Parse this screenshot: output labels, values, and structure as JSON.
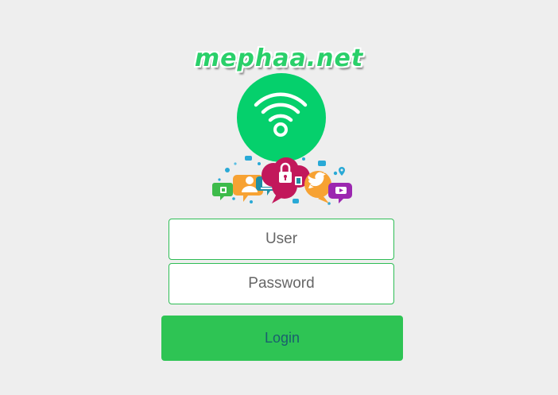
{
  "brand": {
    "name": "mephaa.net",
    "color": "#2ad06a"
  },
  "icons": {
    "badge": "wifi-icon",
    "illustration": "social-media-bubbles-illustration"
  },
  "form": {
    "user_placeholder": "User",
    "password_placeholder": "Password",
    "login_label": "Login"
  },
  "colors": {
    "background": "#eeeeee",
    "accent": "#2ec454",
    "badge": "#05d06c",
    "button_text": "#1a5f6e"
  }
}
